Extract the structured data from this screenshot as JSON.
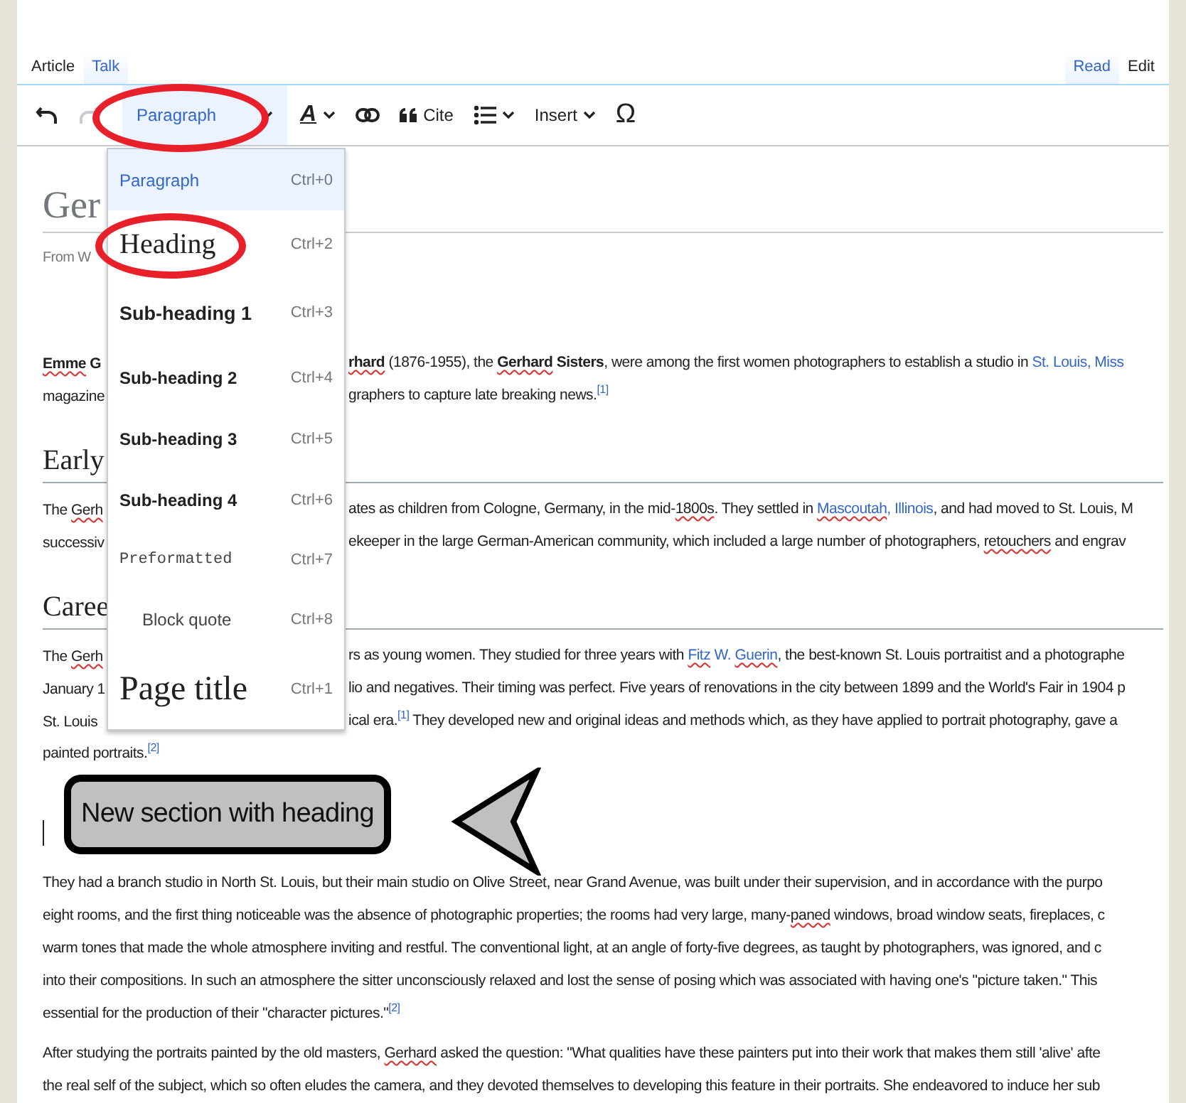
{
  "tabs_left": [
    {
      "label": "Article",
      "selected": true
    },
    {
      "label": "Talk",
      "selected": false
    }
  ],
  "tabs_right": [
    {
      "label": "Read",
      "selected": false
    },
    {
      "label": "Edit",
      "selected": true
    }
  ],
  "toolbar": {
    "undo": {
      "disabled": false
    },
    "redo": {
      "disabled": true
    },
    "format": {
      "label": "Paragraph",
      "expanded": true
    },
    "style_symbol": "A",
    "cite": {
      "label": "Cite"
    },
    "insert": {
      "label": "Insert"
    },
    "special": {
      "symbol": "Ω"
    }
  },
  "format_menu": {
    "options": [
      {
        "kind": "paragraph",
        "label": "Paragraph",
        "shortcut": "Ctrl+0",
        "selected": true
      },
      {
        "kind": "heading",
        "label": "Heading",
        "shortcut": "Ctrl+2",
        "selected": false
      },
      {
        "kind": "sub1",
        "label": "Sub-heading 1",
        "shortcut": "Ctrl+3",
        "selected": false
      },
      {
        "kind": "sub2",
        "label": "Sub-heading 2",
        "shortcut": "Ctrl+4",
        "selected": false
      },
      {
        "kind": "sub3",
        "label": "Sub-heading 3",
        "shortcut": "Ctrl+5",
        "selected": false
      },
      {
        "kind": "sub4",
        "label": "Sub-heading 4",
        "shortcut": "Ctrl+6",
        "selected": false
      },
      {
        "kind": "pre",
        "label": "Preformatted",
        "shortcut": "Ctrl+7",
        "selected": false
      },
      {
        "kind": "quote",
        "label": "Block quote",
        "shortcut": "Ctrl+8",
        "selected": false
      },
      {
        "kind": "title",
        "label": "Page title",
        "shortcut": "Ctrl+1",
        "selected": false
      }
    ]
  },
  "article": [
    {
      "kind": "title",
      "text": "Ger"
    },
    {
      "kind": "subtitle",
      "text": "From W"
    },
    {
      "kind": "para",
      "lines": [
        {
          "parts": [
            [
              {
                "kind": "bold_spell",
                "text": "Emme"
              },
              {
                "kind": "bold",
                "text": " G"
              }
            ],
            [
              {
                "kind": "bold_spell",
                "text": "rhard"
              },
              {
                "kind": "plain",
                "text": " (1876-1955), the "
              },
              {
                "kind": "bold_spell",
                "text": "Gerhard"
              },
              {
                "kind": "bold",
                "text": " Sisters"
              },
              {
                "kind": "plain",
                "text": ", were among the first women photographers to establish a studio in "
              },
              {
                "kind": "link",
                "text": "St. Louis, Miss"
              }
            ]
          ]
        },
        {
          "parts": [
            [
              {
                "kind": "plain",
                "text": "magazine"
              }
            ],
            [
              {
                "kind": "plain",
                "text": "graphers to capture late breaking news."
              },
              {
                "kind": "ref",
                "text": "[1]"
              }
            ]
          ]
        }
      ]
    },
    {
      "kind": "heading",
      "text": "Early"
    },
    {
      "kind": "para",
      "lines": [
        {
          "parts": [
            [
              {
                "kind": "plain",
                "text": "The "
              },
              {
                "kind": "spell",
                "text": "Gerh"
              }
            ],
            [
              {
                "kind": "plain",
                "text": "ates as children from Cologne, Germany, in the mid-"
              },
              {
                "kind": "spell",
                "text": "1800s"
              },
              {
                "kind": "plain",
                "text": ". They settled in "
              },
              {
                "kind": "link_spell",
                "text": "Mascoutah"
              },
              {
                "kind": "link",
                "text": ", Illinois"
              },
              {
                "kind": "plain",
                "text": ", and had moved to St. Louis, M"
              }
            ]
          ]
        },
        {
          "parts": [
            [
              {
                "kind": "plain",
                "text": "successiv"
              }
            ],
            [
              {
                "kind": "plain",
                "text": "ekeeper in the large German-American community, which included a large number of photographers, "
              },
              {
                "kind": "spell",
                "text": "retouchers"
              },
              {
                "kind": "plain",
                "text": " and engrav"
              }
            ]
          ]
        }
      ]
    },
    {
      "kind": "heading",
      "text": "Caree"
    },
    {
      "kind": "para",
      "lines": [
        {
          "parts": [
            [
              {
                "kind": "plain",
                "text": "The "
              },
              {
                "kind": "spell",
                "text": "Gerh"
              }
            ],
            [
              {
                "kind": "plain",
                "text": "rs as young women. They studied for three years with "
              },
              {
                "kind": "link_spell",
                "text": "Fitz"
              },
              {
                "kind": "link",
                "text": " W. "
              },
              {
                "kind": "link_spell",
                "text": "Guerin"
              },
              {
                "kind": "plain",
                "text": ", the best-known St. Louis portraitist and a photographe"
              }
            ]
          ]
        },
        {
          "parts": [
            [
              {
                "kind": "plain",
                "text": "January 1"
              }
            ],
            [
              {
                "kind": "plain",
                "text": "lio and negatives. Their timing was perfect. Five years of renovations in the city between 1899 and the World's Fair in 1904 p"
              }
            ]
          ]
        },
        {
          "parts": [
            [
              {
                "kind": "plain",
                "text": "St. Louis"
              }
            ],
            [
              {
                "kind": "plain",
                "text": "ical era."
              },
              {
                "kind": "ref",
                "text": "[1]"
              },
              {
                "kind": "plain",
                "text": " They developed new and original ideas and methods which, as they have applied to portrait photography, gave a"
              }
            ]
          ]
        },
        {
          "parts": [
            [
              {
                "kind": "plain",
                "text": "painted portraits."
              },
              {
                "kind": "ref",
                "text": "[2]"
              }
            ]
          ]
        }
      ]
    },
    {
      "kind": "cursor"
    },
    {
      "kind": "para",
      "lines": [
        {
          "parts": [
            [
              {
                "kind": "plain",
                "text": "They had a branch studio in North St. Louis, but their main studio on Olive Street, near Grand Avenue, was built under their supervision, and in accordance with the purpo"
              }
            ]
          ]
        },
        {
          "parts": [
            [
              {
                "kind": "plain",
                "text": "eight rooms, and the first thing noticeable was the absence of photographic properties; the rooms had very large, many-"
              },
              {
                "kind": "spell",
                "text": "paned"
              },
              {
                "kind": "plain",
                "text": " windows, broad window seats, fireplaces, c"
              }
            ]
          ]
        },
        {
          "parts": [
            [
              {
                "kind": "plain",
                "text": "warm tones that made the whole atmosphere inviting and restful. The conventional light, at an angle of forty-five degrees, as taught by photographers, was ignored, and c"
              }
            ]
          ]
        },
        {
          "parts": [
            [
              {
                "kind": "plain",
                "text": "into their compositions. In such an atmosphere the sitter unconsciously relaxed and lost the sense of posing which was associated with having one's \"picture taken.\" This"
              }
            ]
          ]
        },
        {
          "parts": [
            [
              {
                "kind": "plain",
                "text": "essential for the production of their \"character pictures.\""
              },
              {
                "kind": "ref",
                "text": "[2]"
              }
            ]
          ]
        }
      ]
    },
    {
      "kind": "para",
      "lines": [
        {
          "parts": [
            [
              {
                "kind": "plain",
                "text": "After studying the portraits painted by the old masters, "
              },
              {
                "kind": "spell",
                "text": "Gerhard"
              },
              {
                "kind": "plain",
                "text": " asked the question: \"What qualities have these painters put into their work that makes them still 'alive' afte"
              }
            ]
          ]
        },
        {
          "parts": [
            [
              {
                "kind": "plain",
                "text": "the real self of the subject, which so often eludes the camera, and they devoted themselves to developing this feature in their portraits. She endeavored to induce her sub"
              }
            ]
          ]
        }
      ]
    }
  ],
  "callout": {
    "text": "New section with heading"
  }
}
